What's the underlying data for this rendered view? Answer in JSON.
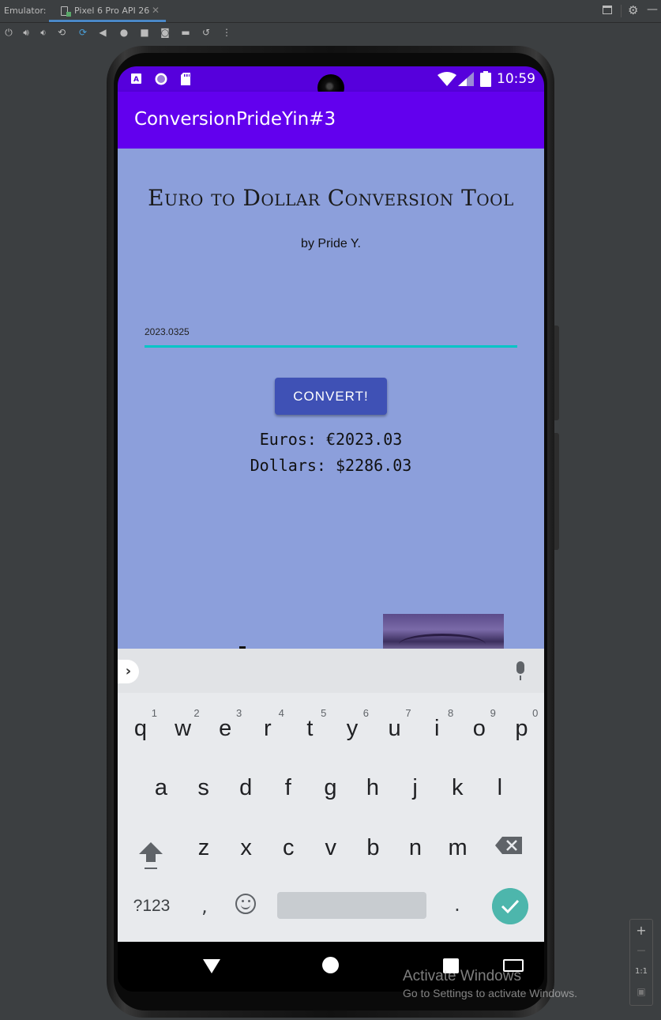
{
  "ide": {
    "emulator_label": "Emulator:",
    "device_tab": "Pixel 6 Pro API 26",
    "tab_close": "✕",
    "gear": "⚙",
    "minimize": "—"
  },
  "toolbar_icons": [
    "power-icon",
    "volume-up-icon",
    "volume-down-icon",
    "rotate-left-icon",
    "rotate-right-icon",
    "back-icon",
    "home-icon",
    "overview-icon",
    "screenshot-icon",
    "record-icon",
    "snapshot-icon",
    "more-icon"
  ],
  "status_bar": {
    "time": "10:59",
    "left_icons": [
      "text-a-icon",
      "circle-icon",
      "sd-card-icon"
    ],
    "right_icons": [
      "wifi-icon",
      "signal-icon",
      "battery-icon"
    ]
  },
  "app": {
    "title": "ConversionPrideYin#3",
    "heading": "Euro to Dollar Conversion Tool",
    "byline": "by Pride Y.",
    "input_value": "2023.0325",
    "convert_label": "CONVERT!",
    "euros_text": "Euros: €2023.03",
    "dollars_text": "Dollars: $2286.03"
  },
  "keyboard": {
    "chevron": "›",
    "row1": [
      [
        "q",
        "1"
      ],
      [
        "w",
        "2"
      ],
      [
        "e",
        "3"
      ],
      [
        "r",
        "4"
      ],
      [
        "t",
        "5"
      ],
      [
        "y",
        "6"
      ],
      [
        "u",
        "7"
      ],
      [
        "i",
        "8"
      ],
      [
        "o",
        "9"
      ],
      [
        "p",
        "0"
      ]
    ],
    "row2": [
      "a",
      "s",
      "d",
      "f",
      "g",
      "h",
      "j",
      "k",
      "l"
    ],
    "row3": [
      "z",
      "x",
      "c",
      "v",
      "b",
      "n",
      "m"
    ],
    "sym_label": "?123",
    "comma": ",",
    "period": "."
  },
  "zoom_panel": {
    "plus": "+",
    "minus": "—",
    "one_to_one": "1:1"
  },
  "watermark": {
    "line1": "Activate Windows",
    "line2": "Go to Settings to activate Windows."
  }
}
